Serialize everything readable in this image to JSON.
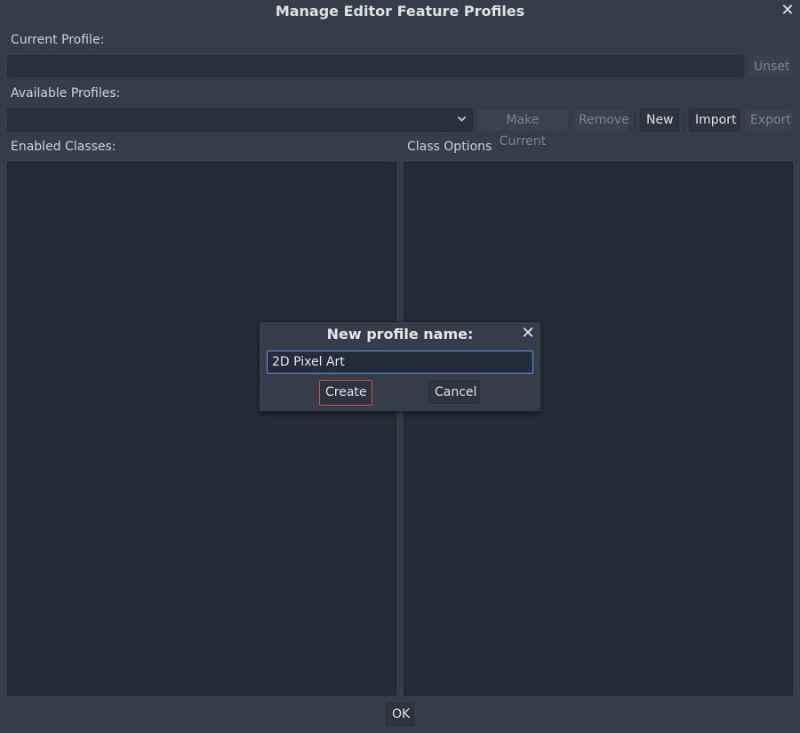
{
  "window": {
    "title": "Manage Editor Feature Profiles",
    "close_icon": "close-icon"
  },
  "current_profile": {
    "label": "Current Profile:",
    "value": "",
    "unset_label": "Unset"
  },
  "available_profiles": {
    "label": "Available Profiles:",
    "selected": "",
    "make_current_label": "Make Current",
    "remove_label": "Remove",
    "new_label": "New",
    "import_label": "Import",
    "export_label": "Export"
  },
  "enabled_classes": {
    "label": "Enabled Classes:"
  },
  "class_options": {
    "label": "Class Options"
  },
  "footer": {
    "ok_label": "OK"
  },
  "popup": {
    "title": "New profile name:",
    "input_value": "2D Pixel Art",
    "create_label": "Create",
    "cancel_label": "Cancel"
  },
  "colors": {
    "background": "#363d4a",
    "panel": "#262c37",
    "focus_border": "#5a9cf8",
    "create_border": "#e04a4a"
  }
}
